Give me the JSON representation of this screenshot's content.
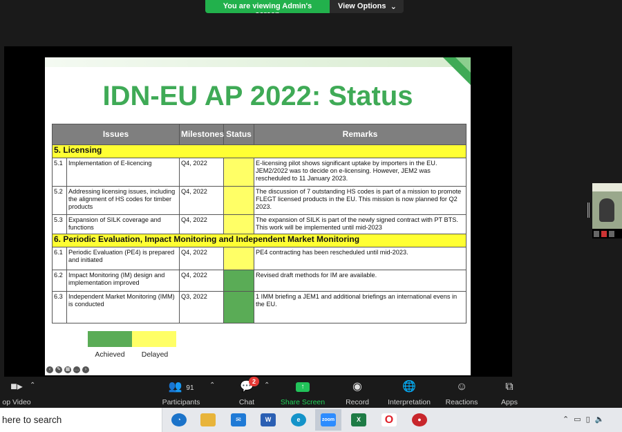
{
  "banner": {
    "viewing_text": "You are viewing Admin's screen",
    "view_options_label": "View Options"
  },
  "slide": {
    "title": "IDN-EU AP 2022: Status",
    "table_headers": {
      "issues": "Issues",
      "milestones": "Milestones",
      "status": "Status",
      "remarks": "Remarks"
    },
    "sections": [
      {
        "title": "5. Licensing",
        "rows": [
          {
            "num": "5.1",
            "issue": "Implementation of E-licencing",
            "milestone": "Q4, 2022",
            "status": "delayed",
            "remarks": "E-licensing pilot shows significant uptake by importers in the EU. JEM2/2022 was to decide on e-licensing. However, JEM2 was rescheduled to 11 January 2023."
          },
          {
            "num": "5.2",
            "issue": "Addressing licensing issues, including the alignment of HS codes for timber products",
            "milestone": "Q4, 2022",
            "status": "delayed",
            "remarks": "The discussion of 7 outstanding HS codes is part of a mission to promote FLEGT licensed products in the EU. This mission is now planned for Q2 2023."
          },
          {
            "num": "5.3",
            "issue": "Expansion of SILK coverage and functions",
            "milestone": "Q4, 2022",
            "status": "delayed",
            "remarks": "The expansion of SILK is part of the newly signed contract with PT BTS. This work will be implemented until mid-2023"
          }
        ]
      },
      {
        "title": "6. Periodic Evaluation, Impact Monitoring and Independent Market Monitoring",
        "rows": [
          {
            "num": "6.1",
            "issue": "Periodic Evaluation (PE4) is prepared and initiated",
            "milestone": "Q4, 2022",
            "status": "delayed",
            "remarks": "PE4 contracting has been rescheduled until mid-2023."
          },
          {
            "num": "6.2",
            "issue": "Impact Monitoring (IM) design and implementation improved",
            "milestone": "Q4, 2022",
            "status": "achieved",
            "remarks": "Revised draft methods for IM are available."
          },
          {
            "num": "6.3",
            "issue": "Independent Market Monitoring (IMM) is conducted",
            "milestone": "Q3, 2022",
            "status": "achieved",
            "remarks": "1 IMM briefing a JEM1 and additional briefings an international evens in the EU."
          }
        ]
      }
    ],
    "legend": {
      "achieved": "Achieved",
      "delayed": "Delayed"
    },
    "colors": {
      "title": "#3faa56",
      "achieved": "#5aac56",
      "delayed": "#ffff66",
      "section": "#ffff33",
      "header": "#7f7f7f"
    }
  },
  "toolbar": {
    "stop_video": "op Video",
    "participants": "Participants",
    "participants_count": "91",
    "chat": "Chat",
    "chat_badge": "2",
    "share_screen": "Share Screen",
    "record": "Record",
    "interpretation": "Interpretation",
    "reactions": "Reactions",
    "apps": "Apps"
  },
  "taskbar": {
    "search_placeholder": "here to search",
    "apps": [
      "outlook-icon",
      "file-explorer-icon",
      "mail-icon",
      "word-icon",
      "edge-icon",
      "zoom-icon",
      "excel-icon",
      "opera-icon",
      "app-icon"
    ],
    "zoom_label": "zoom",
    "word_label": "W",
    "excel_label": "X"
  }
}
